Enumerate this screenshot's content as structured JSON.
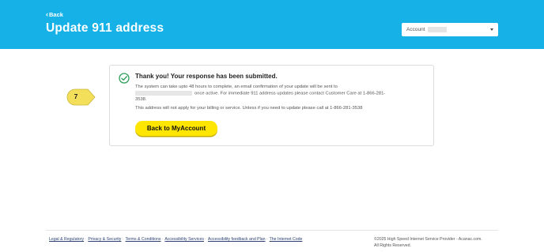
{
  "header": {
    "back_label": "Back",
    "title": "Update 911 address",
    "account_label": "Account"
  },
  "confirmation": {
    "heading": "Thank you! Your response has been submitted.",
    "line1": "The system can take upto 48 hours to complete, an email confirmation of your update will be sent to",
    "line2": "once active. For immediate 911 address updates please contact Customer Care at 1-866-281-",
    "line3": "3538.",
    "line4": "This address will not apply for your billing or service. Unless if you need to update please call at 1-866-281-3538",
    "button_label": "Back to MyAccount"
  },
  "step_marker": {
    "label": "7"
  },
  "footer": {
    "links": [
      "Legal & Regulatory",
      "Privacy & Security",
      "Terms & Conditions",
      "Accessibility Services",
      "Accessibility feedback and Plan",
      "The Internet Code"
    ],
    "copyright_line1": "©2025 High Speed Internet Service Provider - Acanac.com.",
    "copyright_line2": "All Rights Reserved."
  },
  "colors": {
    "header_bg": "#16b1e6",
    "cta_bg": "#ffe600",
    "check_green": "#2e9e5b",
    "step_marker": "#f3df5a"
  },
  "icons": {
    "back": "chevron-left-icon",
    "account_dropdown": "caret-down-icon",
    "success": "check-circle-icon"
  }
}
